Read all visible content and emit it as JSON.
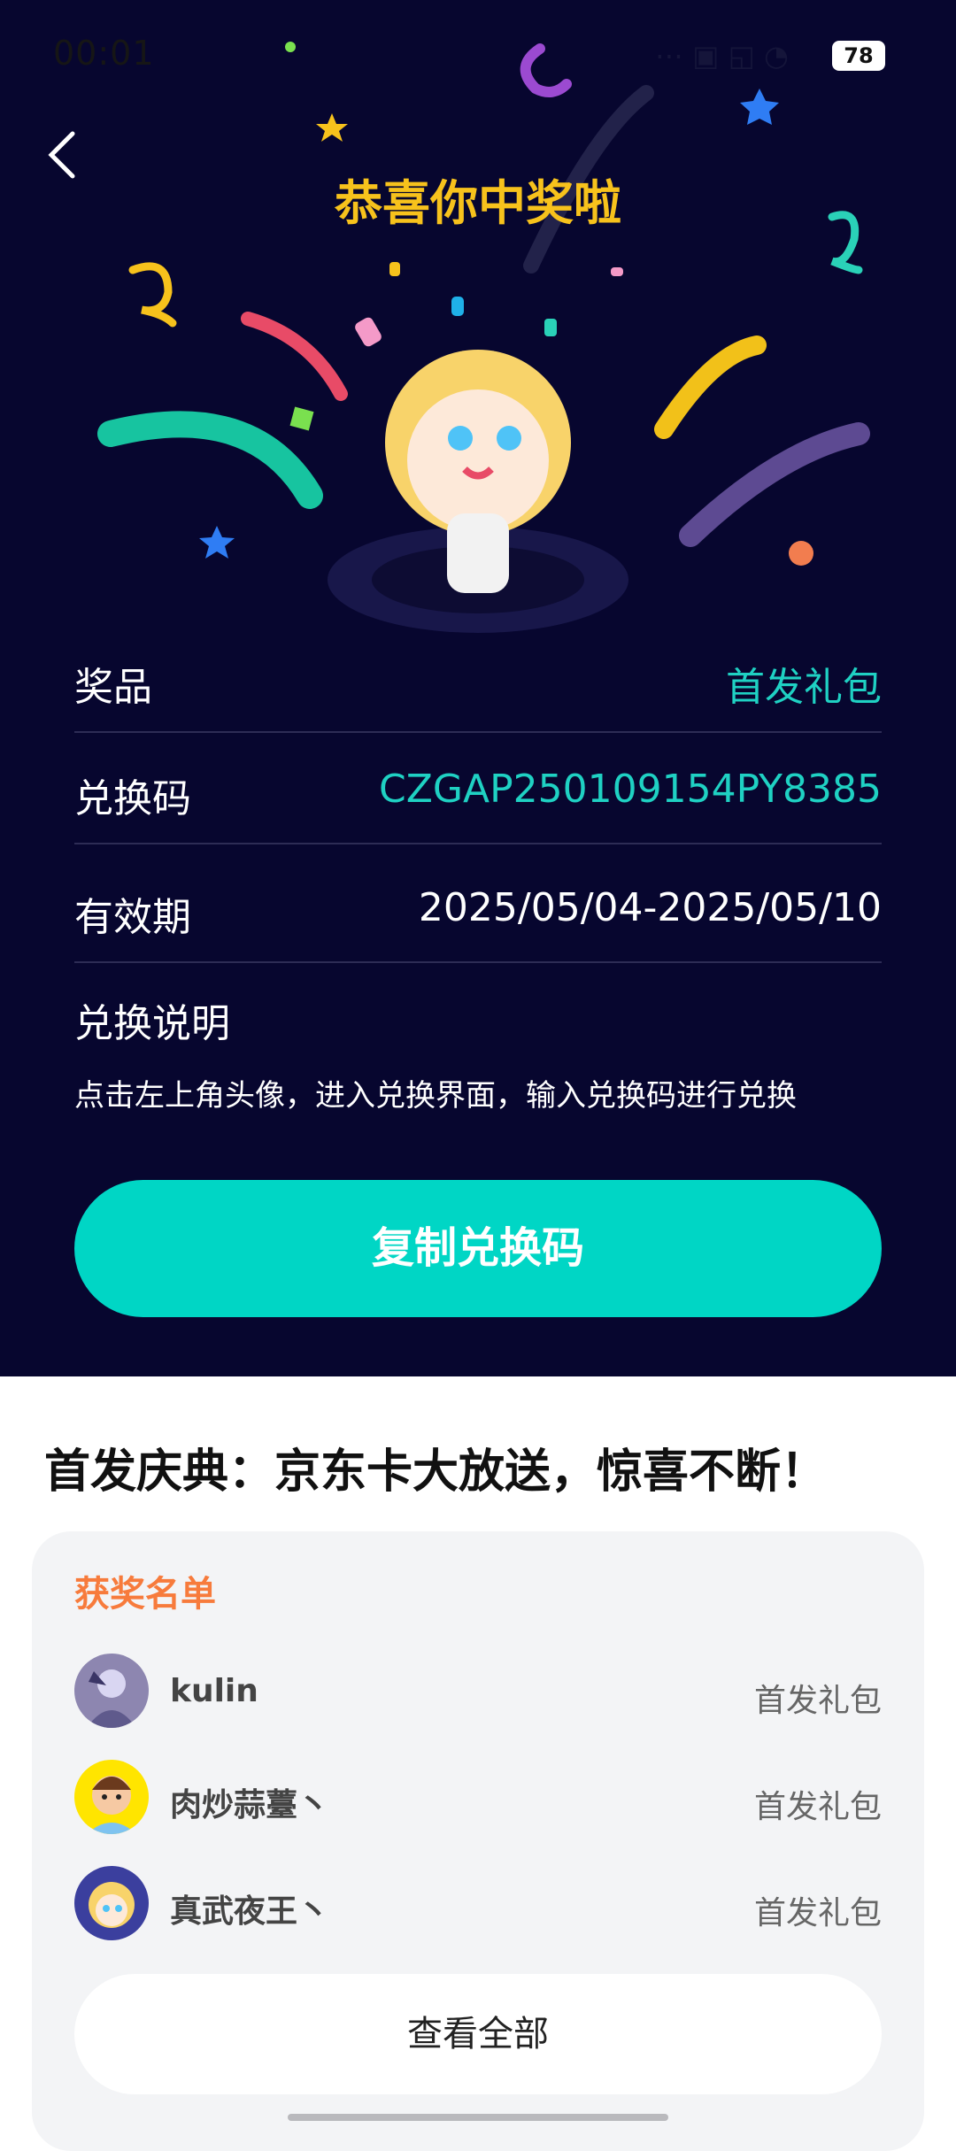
{
  "status_bar": {
    "time": "00:01",
    "battery": "78"
  },
  "header": {
    "title": "恭喜你中奖啦"
  },
  "prize_info": {
    "rows": [
      {
        "label": "奖品",
        "value": "首发礼包"
      },
      {
        "label": "兑换码",
        "value": "CZGAP250109154PY8385"
      },
      {
        "label": "有效期",
        "value": "2025/05/04-2025/05/10"
      }
    ],
    "instructions_title": "兑换说明",
    "instructions_text": "点击左上角头像，进入兑换界面，输入兑换码进行兑换"
  },
  "copy_button": {
    "label": "复制兑换码"
  },
  "promo": {
    "title": "首发庆典：京东卡大放送，惊喜不断！"
  },
  "winners": {
    "title": "获奖名单",
    "items": [
      {
        "name": "kulin",
        "prize": "首发礼包"
      },
      {
        "name": "肉炒蒜薹丶",
        "prize": "首发礼包"
      },
      {
        "name": "真武夜王丶",
        "prize": "首发礼包"
      }
    ],
    "view_all_label": "查看全部"
  },
  "colors": {
    "background": "#07062f",
    "accent": "#00d6c5",
    "title": "#f7c21c",
    "highlight": "#f77b3c"
  }
}
